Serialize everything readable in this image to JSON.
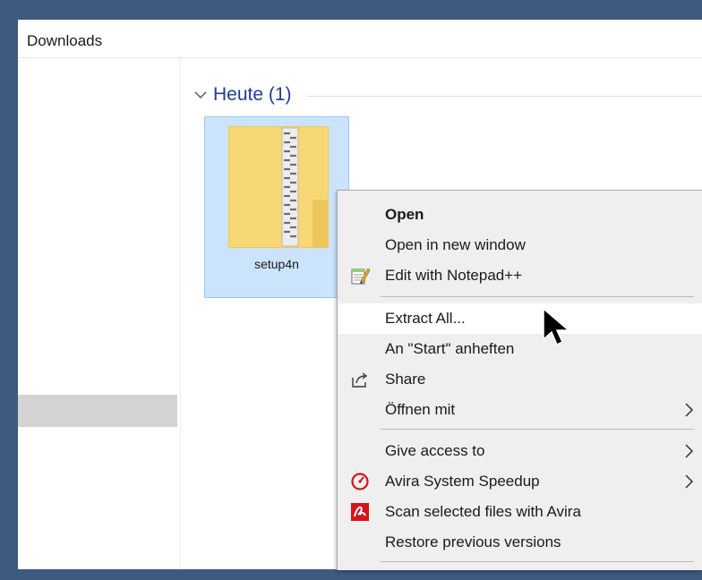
{
  "address_bar": {
    "location": "Downloads"
  },
  "file_group": {
    "title": "Heute (1)"
  },
  "file": {
    "name": "setup4n",
    "icon": "zip-folder-icon"
  },
  "context_menu": {
    "items": [
      {
        "label": "Open",
        "bold": true
      },
      {
        "label": "Open in new window"
      },
      {
        "label": "Edit with Notepad++",
        "icon": "notepad-plus-plus-icon"
      },
      {
        "label": "Extract All...",
        "highlighted": true
      },
      {
        "label": "An \"Start\" anheften"
      },
      {
        "label": "Share",
        "icon": "share-icon"
      },
      {
        "label": "Öffnen mit",
        "submenu": true
      },
      {
        "label": "Give access to",
        "submenu": true
      },
      {
        "label": "Avira System Speedup",
        "icon": "avira-speedup-icon",
        "submenu": true
      },
      {
        "label": "Scan selected files with Avira",
        "icon": "avira-scan-icon"
      },
      {
        "label": "Restore previous versions"
      }
    ]
  },
  "colors": {
    "frame": "#3d5a80",
    "selection": "#cce4fb",
    "group_title": "#1e3f8f",
    "avira_red": "#d4131b"
  }
}
